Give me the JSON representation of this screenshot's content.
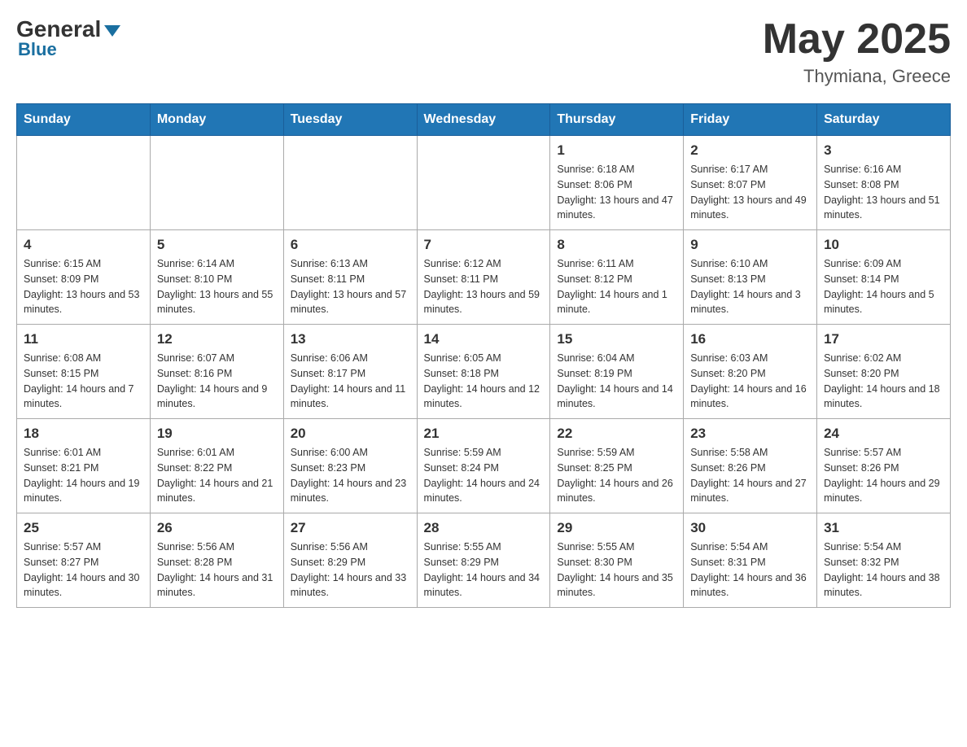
{
  "header": {
    "logo_general": "General",
    "logo_blue": "Blue",
    "month_title": "May 2025",
    "location": "Thymiana, Greece"
  },
  "days_of_week": [
    "Sunday",
    "Monday",
    "Tuesday",
    "Wednesday",
    "Thursday",
    "Friday",
    "Saturday"
  ],
  "weeks": [
    [
      {
        "day": "",
        "info": ""
      },
      {
        "day": "",
        "info": ""
      },
      {
        "day": "",
        "info": ""
      },
      {
        "day": "",
        "info": ""
      },
      {
        "day": "1",
        "info": "Sunrise: 6:18 AM\nSunset: 8:06 PM\nDaylight: 13 hours and 47 minutes."
      },
      {
        "day": "2",
        "info": "Sunrise: 6:17 AM\nSunset: 8:07 PM\nDaylight: 13 hours and 49 minutes."
      },
      {
        "day": "3",
        "info": "Sunrise: 6:16 AM\nSunset: 8:08 PM\nDaylight: 13 hours and 51 minutes."
      }
    ],
    [
      {
        "day": "4",
        "info": "Sunrise: 6:15 AM\nSunset: 8:09 PM\nDaylight: 13 hours and 53 minutes."
      },
      {
        "day": "5",
        "info": "Sunrise: 6:14 AM\nSunset: 8:10 PM\nDaylight: 13 hours and 55 minutes."
      },
      {
        "day": "6",
        "info": "Sunrise: 6:13 AM\nSunset: 8:11 PM\nDaylight: 13 hours and 57 minutes."
      },
      {
        "day": "7",
        "info": "Sunrise: 6:12 AM\nSunset: 8:11 PM\nDaylight: 13 hours and 59 minutes."
      },
      {
        "day": "8",
        "info": "Sunrise: 6:11 AM\nSunset: 8:12 PM\nDaylight: 14 hours and 1 minute."
      },
      {
        "day": "9",
        "info": "Sunrise: 6:10 AM\nSunset: 8:13 PM\nDaylight: 14 hours and 3 minutes."
      },
      {
        "day": "10",
        "info": "Sunrise: 6:09 AM\nSunset: 8:14 PM\nDaylight: 14 hours and 5 minutes."
      }
    ],
    [
      {
        "day": "11",
        "info": "Sunrise: 6:08 AM\nSunset: 8:15 PM\nDaylight: 14 hours and 7 minutes."
      },
      {
        "day": "12",
        "info": "Sunrise: 6:07 AM\nSunset: 8:16 PM\nDaylight: 14 hours and 9 minutes."
      },
      {
        "day": "13",
        "info": "Sunrise: 6:06 AM\nSunset: 8:17 PM\nDaylight: 14 hours and 11 minutes."
      },
      {
        "day": "14",
        "info": "Sunrise: 6:05 AM\nSunset: 8:18 PM\nDaylight: 14 hours and 12 minutes."
      },
      {
        "day": "15",
        "info": "Sunrise: 6:04 AM\nSunset: 8:19 PM\nDaylight: 14 hours and 14 minutes."
      },
      {
        "day": "16",
        "info": "Sunrise: 6:03 AM\nSunset: 8:20 PM\nDaylight: 14 hours and 16 minutes."
      },
      {
        "day": "17",
        "info": "Sunrise: 6:02 AM\nSunset: 8:20 PM\nDaylight: 14 hours and 18 minutes."
      }
    ],
    [
      {
        "day": "18",
        "info": "Sunrise: 6:01 AM\nSunset: 8:21 PM\nDaylight: 14 hours and 19 minutes."
      },
      {
        "day": "19",
        "info": "Sunrise: 6:01 AM\nSunset: 8:22 PM\nDaylight: 14 hours and 21 minutes."
      },
      {
        "day": "20",
        "info": "Sunrise: 6:00 AM\nSunset: 8:23 PM\nDaylight: 14 hours and 23 minutes."
      },
      {
        "day": "21",
        "info": "Sunrise: 5:59 AM\nSunset: 8:24 PM\nDaylight: 14 hours and 24 minutes."
      },
      {
        "day": "22",
        "info": "Sunrise: 5:59 AM\nSunset: 8:25 PM\nDaylight: 14 hours and 26 minutes."
      },
      {
        "day": "23",
        "info": "Sunrise: 5:58 AM\nSunset: 8:26 PM\nDaylight: 14 hours and 27 minutes."
      },
      {
        "day": "24",
        "info": "Sunrise: 5:57 AM\nSunset: 8:26 PM\nDaylight: 14 hours and 29 minutes."
      }
    ],
    [
      {
        "day": "25",
        "info": "Sunrise: 5:57 AM\nSunset: 8:27 PM\nDaylight: 14 hours and 30 minutes."
      },
      {
        "day": "26",
        "info": "Sunrise: 5:56 AM\nSunset: 8:28 PM\nDaylight: 14 hours and 31 minutes."
      },
      {
        "day": "27",
        "info": "Sunrise: 5:56 AM\nSunset: 8:29 PM\nDaylight: 14 hours and 33 minutes."
      },
      {
        "day": "28",
        "info": "Sunrise: 5:55 AM\nSunset: 8:29 PM\nDaylight: 14 hours and 34 minutes."
      },
      {
        "day": "29",
        "info": "Sunrise: 5:55 AM\nSunset: 8:30 PM\nDaylight: 14 hours and 35 minutes."
      },
      {
        "day": "30",
        "info": "Sunrise: 5:54 AM\nSunset: 8:31 PM\nDaylight: 14 hours and 36 minutes."
      },
      {
        "day": "31",
        "info": "Sunrise: 5:54 AM\nSunset: 8:32 PM\nDaylight: 14 hours and 38 minutes."
      }
    ]
  ]
}
